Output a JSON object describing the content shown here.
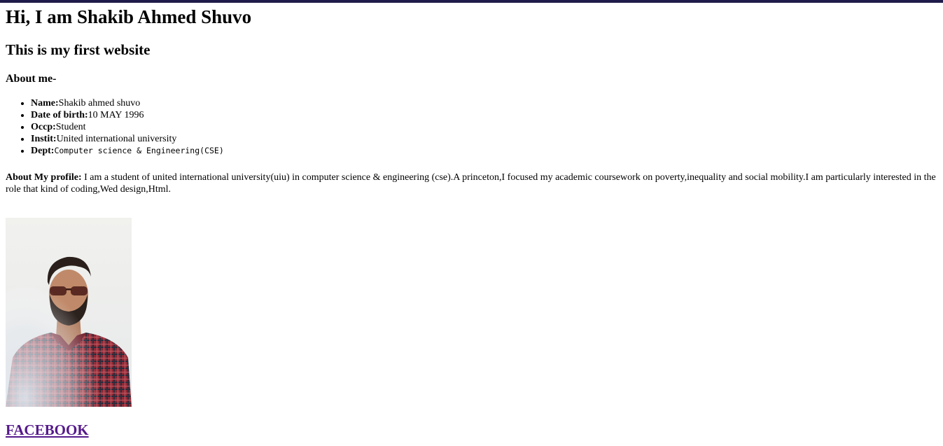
{
  "header": {
    "title": "Hi, I am Shakib Ahmed Shuvo",
    "subtitle": "This is my first website",
    "about_heading": "About me-"
  },
  "about": {
    "items": [
      {
        "label": "Name:",
        "value": "Shakib ahmed shuvo"
      },
      {
        "label": "Date of birth:",
        "value": "10 MAY 1996"
      },
      {
        "label": "Occp:",
        "value": "Student"
      },
      {
        "label": "Instit:",
        "value": "United international university"
      },
      {
        "label": "Dept:",
        "value": "Computer science & Engineering(CSE)"
      }
    ]
  },
  "profile": {
    "label": "About My profile:",
    "text": " I am a student of united international university(uiu) in computer science & engineering (cse).A princeton,I focused my academic coursework on poverty,inequality and social mobility.I am particularly interested in the role that kind of coding,Wed design,Html."
  },
  "links": {
    "facebook": "FACEBOOK"
  },
  "colors": {
    "link_visited": "#551a8b",
    "topbar": "#1f1b4a"
  }
}
